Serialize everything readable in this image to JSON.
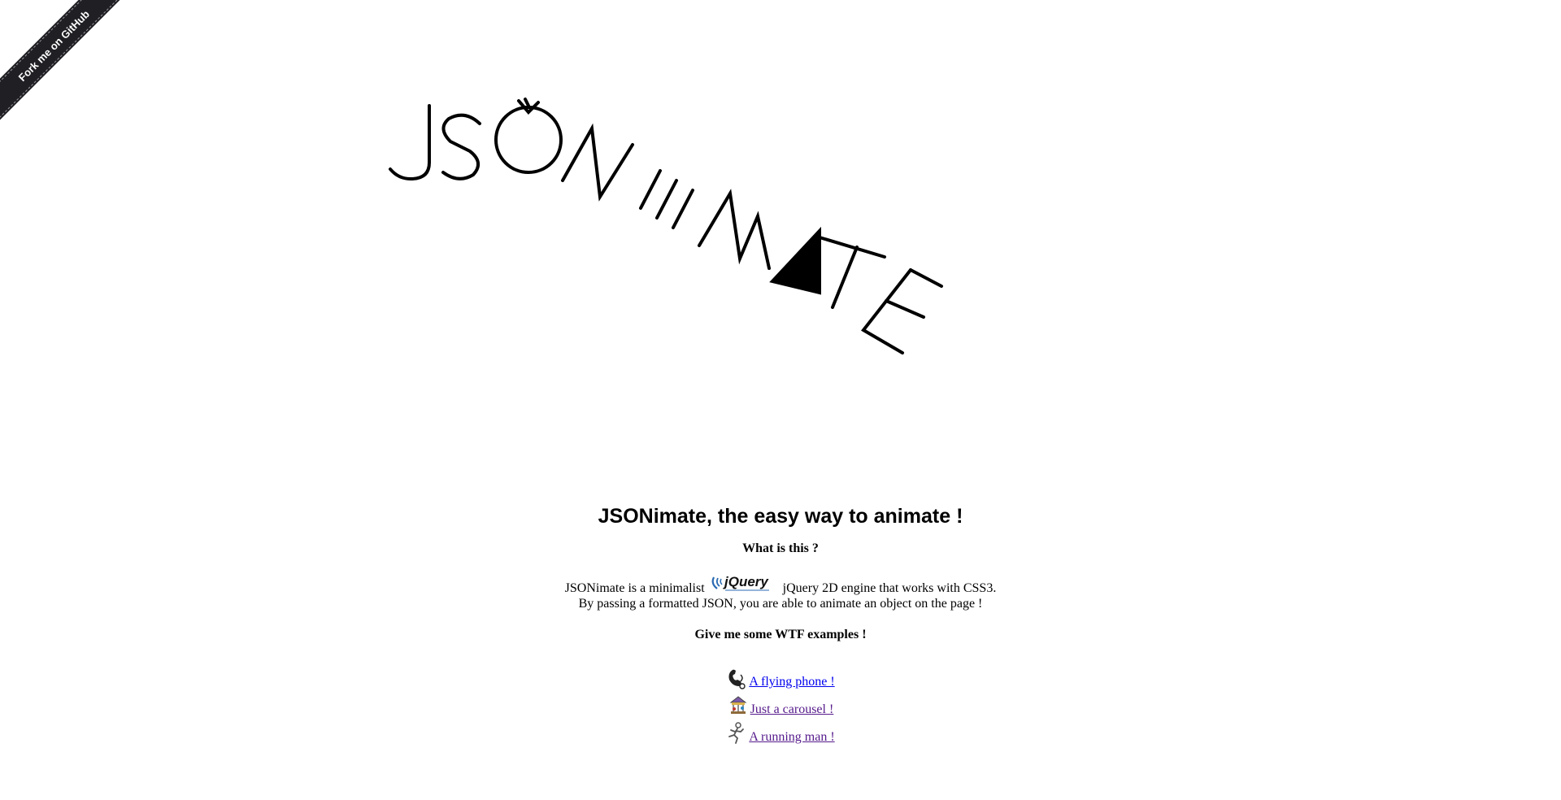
{
  "ribbon": {
    "label": "Fork me on GitHub"
  },
  "headline": "JSONimate, the easy way to animate !",
  "what_title": "What is this ?",
  "description": {
    "line1_before": "JSONimate is a minimalist",
    "jquery_logo_text": "jQuery",
    "line1_after": "jQuery 2D engine that works with CSS3.",
    "line2": "By passing a formatted JSON, you are able to animate an object on the page !"
  },
  "examples_title": "Give me some WTF examples !",
  "examples": [
    {
      "label": " A flying phone ! ",
      "icon": "phone-icon"
    },
    {
      "label": " Just a carousel ! ",
      "icon": "carousel-icon"
    },
    {
      "label": " A running man ! ",
      "icon": "running-man-icon"
    }
  ],
  "colors": {
    "link": "#0000ee",
    "visited": "#551a8b",
    "ribbon": "#1f1f24"
  }
}
